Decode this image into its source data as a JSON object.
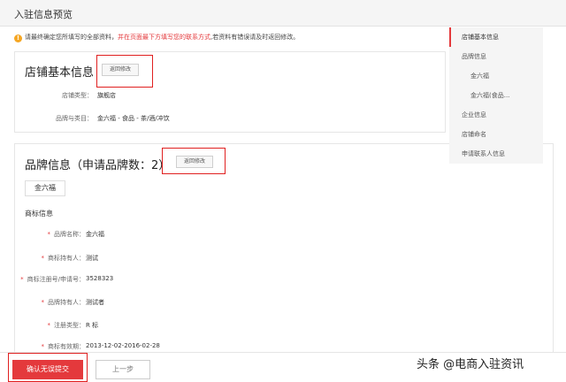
{
  "header": {
    "title": "入驻信息预览"
  },
  "notice": {
    "icon": "warning-icon",
    "text_before": "请最终确定您所填写的全部资料，",
    "text_red": "并在页面最下方填写您的联系方式",
    "text_after": ",若资料有错误请及时返回修改。"
  },
  "store_info": {
    "title": "店铺基本信息",
    "back_label": "返回修改",
    "rows": [
      {
        "label": "店铺类型：",
        "value": "旗舰店"
      },
      {
        "label": "品牌与类目：",
        "value": "金六福 - 食品 - 茶/酒/冲饮"
      }
    ]
  },
  "brand_info": {
    "title": "品牌信息（申请品牌数：2）",
    "back_label": "返回修改",
    "brand_tab": "金六福",
    "section_label": "商标信息",
    "rows": [
      {
        "label": "品牌名称：",
        "value": "金六福"
      },
      {
        "label": "商标持有人：",
        "value": "测试"
      },
      {
        "label": "商标注册号/申请号：",
        "value": "3528323"
      },
      {
        "label": "品牌持有人：",
        "value": "测试者"
      },
      {
        "label": "注册类型：",
        "value": "R 标"
      },
      {
        "label": "商标有效期：",
        "value": "2013-12-02-2016-02-28"
      }
    ]
  },
  "side_nav": {
    "items": [
      {
        "label": "店铺基本信息"
      },
      {
        "label": "品牌信息"
      },
      {
        "label": "金六福"
      },
      {
        "label": "金六福(食品..."
      },
      {
        "label": "企业信息"
      },
      {
        "label": "店铺命名"
      },
      {
        "label": "申请联系人信息"
      }
    ]
  },
  "footer": {
    "confirm_label": "确认无误提交",
    "prev_label": "上一步"
  },
  "watermark": "头条 @电商入驻资讯",
  "colors": {
    "accent": "#e4393c",
    "highlight": "#e02020",
    "warning": "#f5a623"
  }
}
